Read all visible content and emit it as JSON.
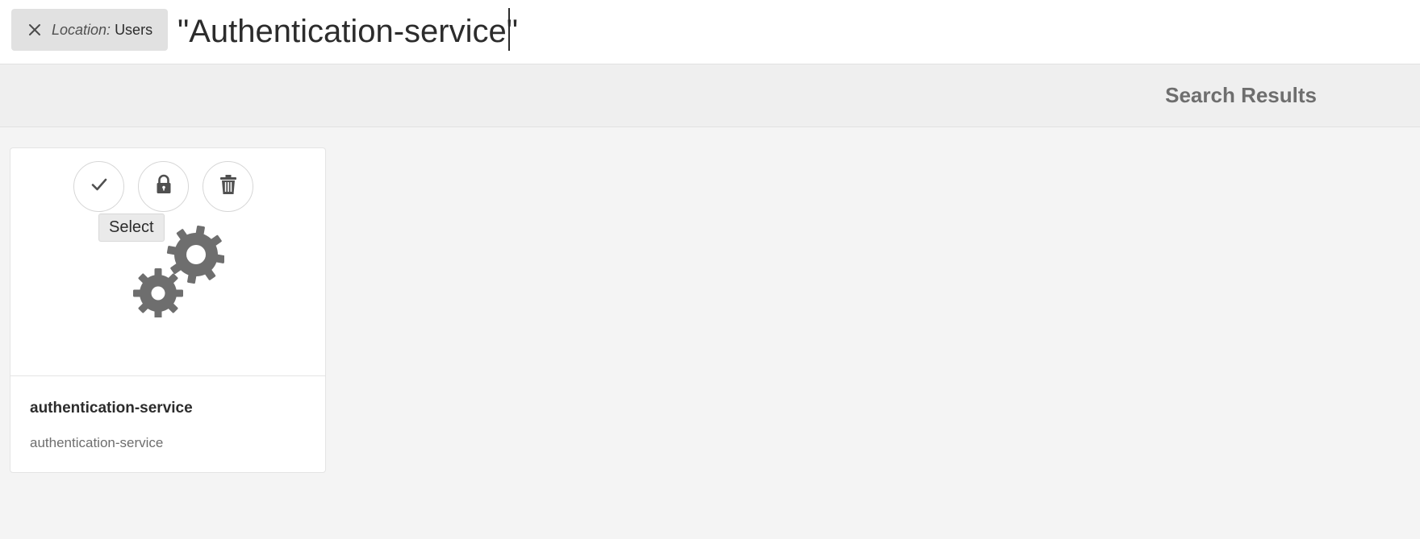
{
  "search": {
    "location_label": "Location:",
    "location_value": "Users",
    "query": "\"Authentication-service\""
  },
  "results": {
    "title": "Search Results"
  },
  "card": {
    "title": "authentication-service",
    "subtitle": "authentication-service",
    "tooltip": "Select",
    "actions": [
      "check-icon",
      "lock-icon",
      "trash-icon"
    ],
    "thumbnail_icon": "gears-icon"
  },
  "colors": {
    "icon_gray": "#6e6e6e",
    "header_bg": "#efefef",
    "page_bg": "#f4f4f4"
  }
}
